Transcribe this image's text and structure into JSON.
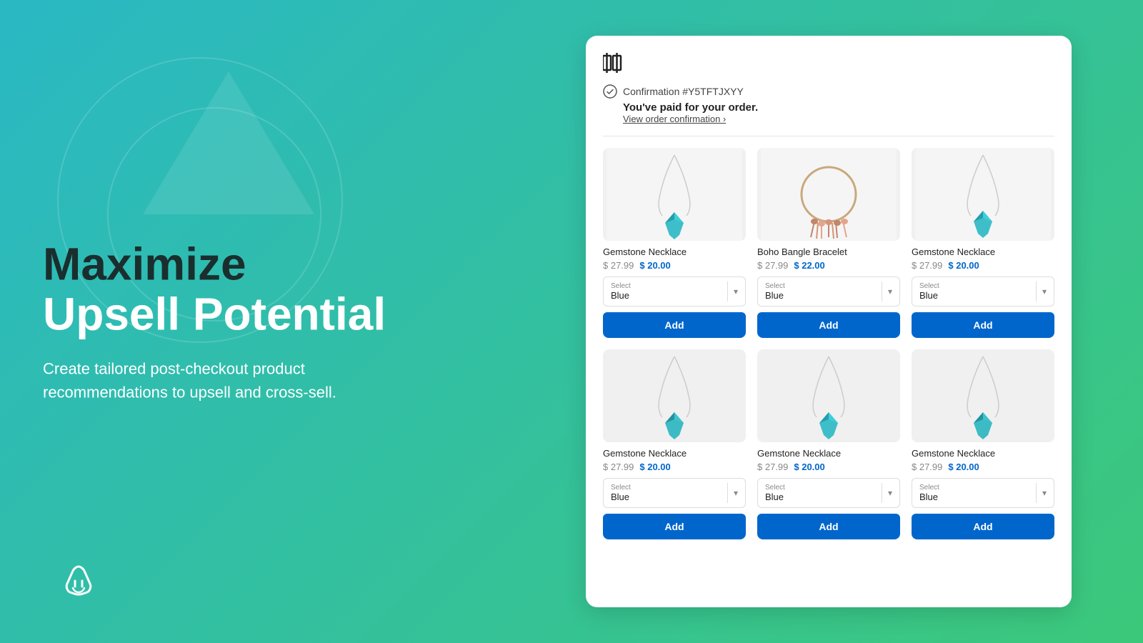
{
  "background": {
    "gradient_start": "#2ab8c4",
    "gradient_end": "#3cc87a"
  },
  "left_panel": {
    "headline_line1": "Maximize",
    "headline_line2": "Upsell Potential",
    "subtext": "Create tailored post-checkout product recommendations to upsell and cross-sell."
  },
  "card": {
    "logo_text": "⬚|⬚",
    "confirmation_number": "Confirmation #Y5TFTJXYY",
    "paid_text": "You've paid for your order.",
    "view_order_link": "View order confirmation ›",
    "products": [
      {
        "name": "Gemstone Necklace",
        "price_original": "$ 27.99",
        "price_sale": "$ 20.00",
        "select_label": "Select",
        "select_value": "Blue",
        "add_label": "Add",
        "image_type": "gemstone_teal"
      },
      {
        "name": "Boho Bangle Bracelet",
        "price_original": "$ 27.99",
        "price_sale": "$ 22.00",
        "select_label": "Select",
        "select_value": "Blue",
        "add_label": "Add",
        "image_type": "boho_bracelet"
      },
      {
        "name": "Gemstone Necklace",
        "price_original": "$ 27.99",
        "price_sale": "$ 20.00",
        "select_label": "Select",
        "select_value": "Blue",
        "add_label": "Add",
        "image_type": "gemstone_teal"
      },
      {
        "name": "Gemstone Necklace",
        "price_original": "$ 27.99",
        "price_sale": "$ 20.00",
        "select_label": "Select",
        "select_value": "Blue",
        "add_label": "Add",
        "image_type": "gemstone_teal"
      },
      {
        "name": "Gemstone Necklace",
        "price_original": "$ 27.99",
        "price_sale": "$ 20.00",
        "select_label": "Select",
        "select_value": "Blue",
        "add_label": "Add",
        "image_type": "gemstone_teal"
      },
      {
        "name": "Gemstone Necklace",
        "price_original": "$ 27.99",
        "price_sale": "$ 20.00",
        "select_label": "Select",
        "select_value": "Blue",
        "add_label": "Add",
        "image_type": "gemstone_teal"
      }
    ]
  }
}
